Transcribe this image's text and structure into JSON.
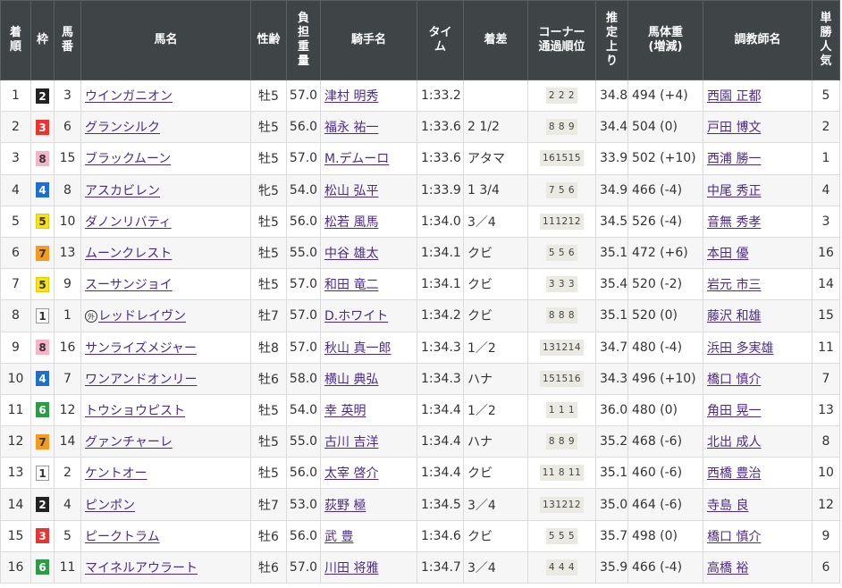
{
  "headers": {
    "chakujun": [
      "着",
      "順"
    ],
    "waku": "枠",
    "umaban": [
      "馬",
      "番"
    ],
    "bamei": "馬名",
    "seirei": "性齢",
    "futan": [
      "負",
      "担",
      "重",
      "量"
    ],
    "kishu": "騎手名",
    "time": [
      "タイ",
      "ム"
    ],
    "chakusa": "着差",
    "corner": [
      "コーナー",
      "通過順位"
    ],
    "agari": [
      "推",
      "定",
      "上",
      "り"
    ],
    "bataiju": [
      "馬体重",
      "(増減)"
    ],
    "chokyoshi": "調教師名",
    "ninki": [
      "単",
      "勝",
      "人",
      "気"
    ]
  },
  "waku_colors": {
    "1": {
      "bg": "#ffffff",
      "fg": "#333333",
      "border": "#999999"
    },
    "2": {
      "bg": "#222222",
      "fg": "#ffffff",
      "border": "#222222"
    },
    "3": {
      "bg": "#e8352f",
      "fg": "#ffffff",
      "border": "#e8352f"
    },
    "4": {
      "bg": "#1f6fd0",
      "fg": "#ffffff",
      "border": "#1f6fd0"
    },
    "5": {
      "bg": "#f6e21a",
      "fg": "#333333",
      "border": "#e0cc00"
    },
    "6": {
      "bg": "#2b9b46",
      "fg": "#ffffff",
      "border": "#2b9b46"
    },
    "7": {
      "bg": "#f59b22",
      "fg": "#333333",
      "border": "#f59b22"
    },
    "8": {
      "bg": "#f7b4c8",
      "fg": "#333333",
      "border": "#f7b4c8"
    }
  },
  "rows": [
    {
      "pos": "1",
      "waku": "2",
      "num": "3",
      "name": "ウインガニオン",
      "foreign": false,
      "sex": "牡5",
      "weight": "57.0",
      "jockey": "津村 明秀",
      "time": "1:33.2",
      "margin": "",
      "corner": "2 2 2",
      "agari": "34.8",
      "body": "494 (+4)",
      "trainer": "西園 正都",
      "pop": "5"
    },
    {
      "pos": "2",
      "waku": "3",
      "num": "6",
      "name": "グランシルク",
      "foreign": false,
      "sex": "牡5",
      "weight": "56.0",
      "jockey": "福永 祐一",
      "time": "1:33.6",
      "margin": "2 1/2",
      "corner": "8 8 9",
      "agari": "34.4",
      "body": "504 (0)",
      "trainer": "戸田 博文",
      "pop": "2"
    },
    {
      "pos": "3",
      "waku": "8",
      "num": "15",
      "name": "ブラックムーン",
      "foreign": false,
      "sex": "牡5",
      "weight": "57.0",
      "jockey": "M.デムーロ",
      "time": "1:33.6",
      "margin": "アタマ",
      "corner": "161515",
      "agari": "33.9",
      "body": "502 (+10)",
      "trainer": "西浦 勝一",
      "pop": "1"
    },
    {
      "pos": "4",
      "waku": "4",
      "num": "8",
      "name": "アスカビレン",
      "foreign": false,
      "sex": "牝5",
      "weight": "54.0",
      "jockey": "松山 弘平",
      "time": "1:33.9",
      "margin": "1 3/4",
      "corner": "7 5 6",
      "agari": "34.9",
      "body": "466 (-4)",
      "trainer": "中尾 秀正",
      "pop": "4"
    },
    {
      "pos": "5",
      "waku": "5",
      "num": "10",
      "name": "ダノンリバティ",
      "foreign": false,
      "sex": "牡5",
      "weight": "56.0",
      "jockey": "松若 風馬",
      "time": "1:34.0",
      "margin": "3／4",
      "corner": "111212",
      "agari": "34.5",
      "body": "526 (-4)",
      "trainer": "音無 秀孝",
      "pop": "3"
    },
    {
      "pos": "6",
      "waku": "7",
      "num": "13",
      "name": "ムーンクレスト",
      "foreign": false,
      "sex": "牡5",
      "weight": "55.0",
      "jockey": "中谷 雄太",
      "time": "1:34.1",
      "margin": "クビ",
      "corner": "5 5 6",
      "agari": "35.1",
      "body": "472 (+6)",
      "trainer": "本田 優",
      "pop": "16"
    },
    {
      "pos": "7",
      "waku": "5",
      "num": "9",
      "name": "スーサンジョイ",
      "foreign": false,
      "sex": "牡5",
      "weight": "57.0",
      "jockey": "和田 竜二",
      "time": "1:34.1",
      "margin": "クビ",
      "corner": "3 3 3",
      "agari": "35.4",
      "body": "520 (-2)",
      "trainer": "岩元 市三",
      "pop": "14"
    },
    {
      "pos": "8",
      "waku": "1",
      "num": "1",
      "name": "レッドレイヴン",
      "foreign": true,
      "sex": "牡7",
      "weight": "57.0",
      "jockey": "D.ホワイト",
      "time": "1:34.2",
      "margin": "クビ",
      "corner": "8 8 8",
      "agari": "35.1",
      "body": "520 (0)",
      "trainer": "藤沢 和雄",
      "pop": "15"
    },
    {
      "pos": "9",
      "waku": "8",
      "num": "16",
      "name": "サンライズメジャー",
      "foreign": false,
      "sex": "牡8",
      "weight": "57.0",
      "jockey": "秋山 真一郎",
      "time": "1:34.3",
      "margin": "1／2",
      "corner": "131214",
      "agari": "34.7",
      "body": "480 (-4)",
      "trainer": "浜田 多実雄",
      "pop": "11"
    },
    {
      "pos": "10",
      "waku": "4",
      "num": "7",
      "name": "ワンアンドオンリー",
      "foreign": false,
      "sex": "牡6",
      "weight": "58.0",
      "jockey": "横山 典弘",
      "time": "1:34.3",
      "margin": "ハナ",
      "corner": "151516",
      "agari": "34.3",
      "body": "496 (+10)",
      "trainer": "橋口 慎介",
      "pop": "7"
    },
    {
      "pos": "11",
      "waku": "6",
      "num": "12",
      "name": "トウショウピスト",
      "foreign": false,
      "sex": "牡5",
      "weight": "54.0",
      "jockey": "幸 英明",
      "time": "1:34.4",
      "margin": "1／2",
      "corner": "1 1 1",
      "agari": "36.0",
      "body": "480 (0)",
      "trainer": "角田 晃一",
      "pop": "13"
    },
    {
      "pos": "12",
      "waku": "7",
      "num": "14",
      "name": "グァンチャーレ",
      "foreign": false,
      "sex": "牡5",
      "weight": "55.0",
      "jockey": "古川 吉洋",
      "time": "1:34.4",
      "margin": "ハナ",
      "corner": "8 8 9",
      "agari": "35.2",
      "body": "468 (-6)",
      "trainer": "北出 成人",
      "pop": "8"
    },
    {
      "pos": "13",
      "waku": "1",
      "num": "2",
      "name": "ケントオー",
      "foreign": false,
      "sex": "牡5",
      "weight": "56.0",
      "jockey": "太宰 啓介",
      "time": "1:34.4",
      "margin": "クビ",
      "corner": "11 8 11",
      "agari": "35.1",
      "body": "460 (-6)",
      "trainer": "西橋 豊治",
      "pop": "10"
    },
    {
      "pos": "14",
      "waku": "2",
      "num": "4",
      "name": "ピンポン",
      "foreign": false,
      "sex": "牡7",
      "weight": "53.0",
      "jockey": "荻野 極",
      "time": "1:34.5",
      "margin": "3／4",
      "corner": "131212",
      "agari": "35.0",
      "body": "464 (-6)",
      "trainer": "寺島 良",
      "pop": "12"
    },
    {
      "pos": "15",
      "waku": "3",
      "num": "5",
      "name": "ピークトラム",
      "foreign": false,
      "sex": "牡6",
      "weight": "56.0",
      "jockey": "武 豊",
      "time": "1:34.6",
      "margin": "クビ",
      "corner": "5 5 5",
      "agari": "35.7",
      "body": "498 (0)",
      "trainer": "橋口 慎介",
      "pop": "9"
    },
    {
      "pos": "16",
      "waku": "6",
      "num": "11",
      "name": "マイネルアウラート",
      "foreign": false,
      "sex": "牡6",
      "weight": "57.0",
      "jockey": "川田 将雅",
      "time": "1:34.7",
      "margin": "3／4",
      "corner": "4 4 4",
      "agari": "35.9",
      "body": "466 (-4)",
      "trainer": "高橋 裕",
      "pop": "6"
    }
  ],
  "foreign_mark": "外"
}
